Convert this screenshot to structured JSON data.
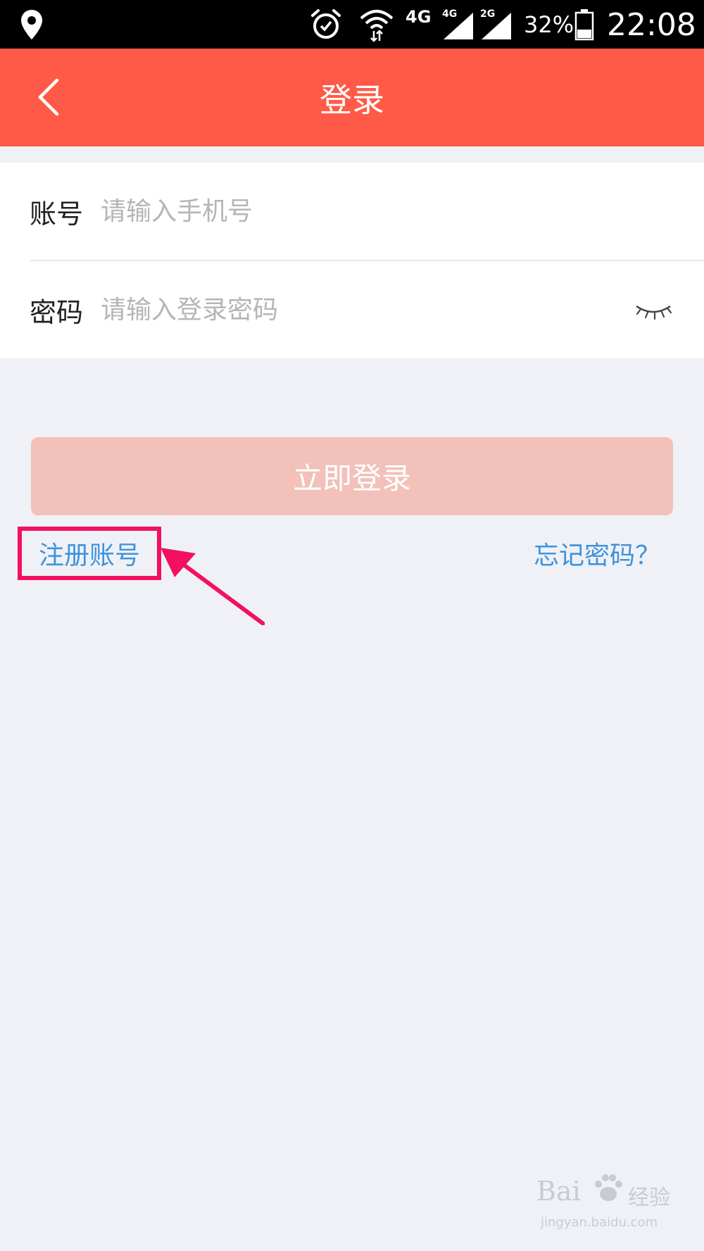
{
  "status_bar": {
    "network_4g": "4G",
    "sim1_label": "4G",
    "sim2_label": "2G",
    "battery_percent": "32%",
    "time": "22:08"
  },
  "app_bar": {
    "title": "登录"
  },
  "form": {
    "account_label": "账号",
    "account_placeholder": "请输入手机号",
    "account_value": "",
    "password_label": "密码",
    "password_placeholder": "请输入登录密码",
    "password_value": ""
  },
  "actions": {
    "login_label": "立即登录",
    "register_label": "注册账号",
    "forgot_label": "忘记密码？"
  },
  "watermark": {
    "brand": "Bai",
    "brand_cn": "经验",
    "url": "jingyan.baidu.com"
  },
  "colors": {
    "accent": "#ff5a47",
    "login_button": "#f2c1b9",
    "link": "#3f93dc",
    "highlight": "#f2105f",
    "page_bg": "#f0f1f6"
  }
}
